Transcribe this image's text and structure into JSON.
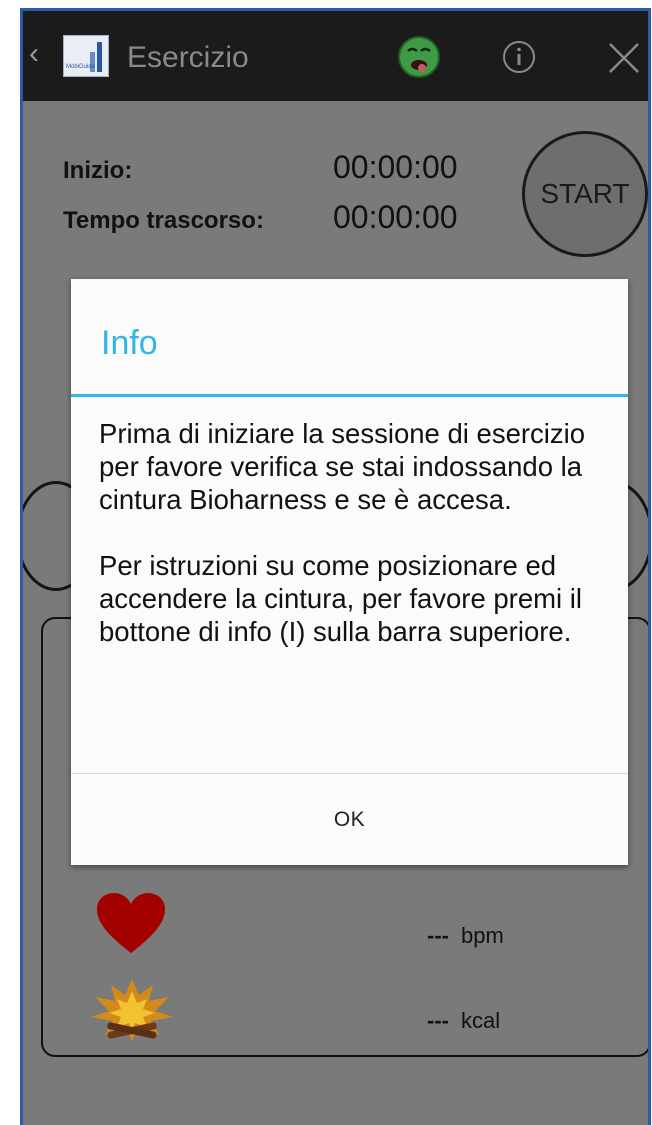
{
  "actionbar": {
    "back_glyph": "‹",
    "title": "Esercizio",
    "icons": [
      "app-logo",
      "sick-face-icon",
      "info-icon",
      "close-icon"
    ]
  },
  "session": {
    "start_label": "Inizio:",
    "start_value": "00:00:00",
    "elapsed_label": "Tempo trascorso:",
    "elapsed_value": "00:00:00",
    "start_button": "START"
  },
  "stats": [
    {
      "icon": "heart-icon",
      "value": "---",
      "unit": "bpm"
    },
    {
      "icon": "fire-icon",
      "value": "---",
      "unit": "kcal"
    }
  ],
  "dialog": {
    "title": "Info",
    "message": "Prima di iniziare la sessione di esercizio per favore verifica se stai indossando la cintura Bioharness e se è accesa.\n\n Per istruzioni su come posizionare ed accendere la cintura, per favore premi il bottone di info (I) sulla barra superiore.",
    "ok_label": "OK"
  },
  "colors": {
    "accent": "#33b5e5",
    "actionbar": "#1b1b1b",
    "dim_background": "#7a7a7a",
    "heart": "#b00000",
    "frame_border": "#2b5aa8"
  }
}
